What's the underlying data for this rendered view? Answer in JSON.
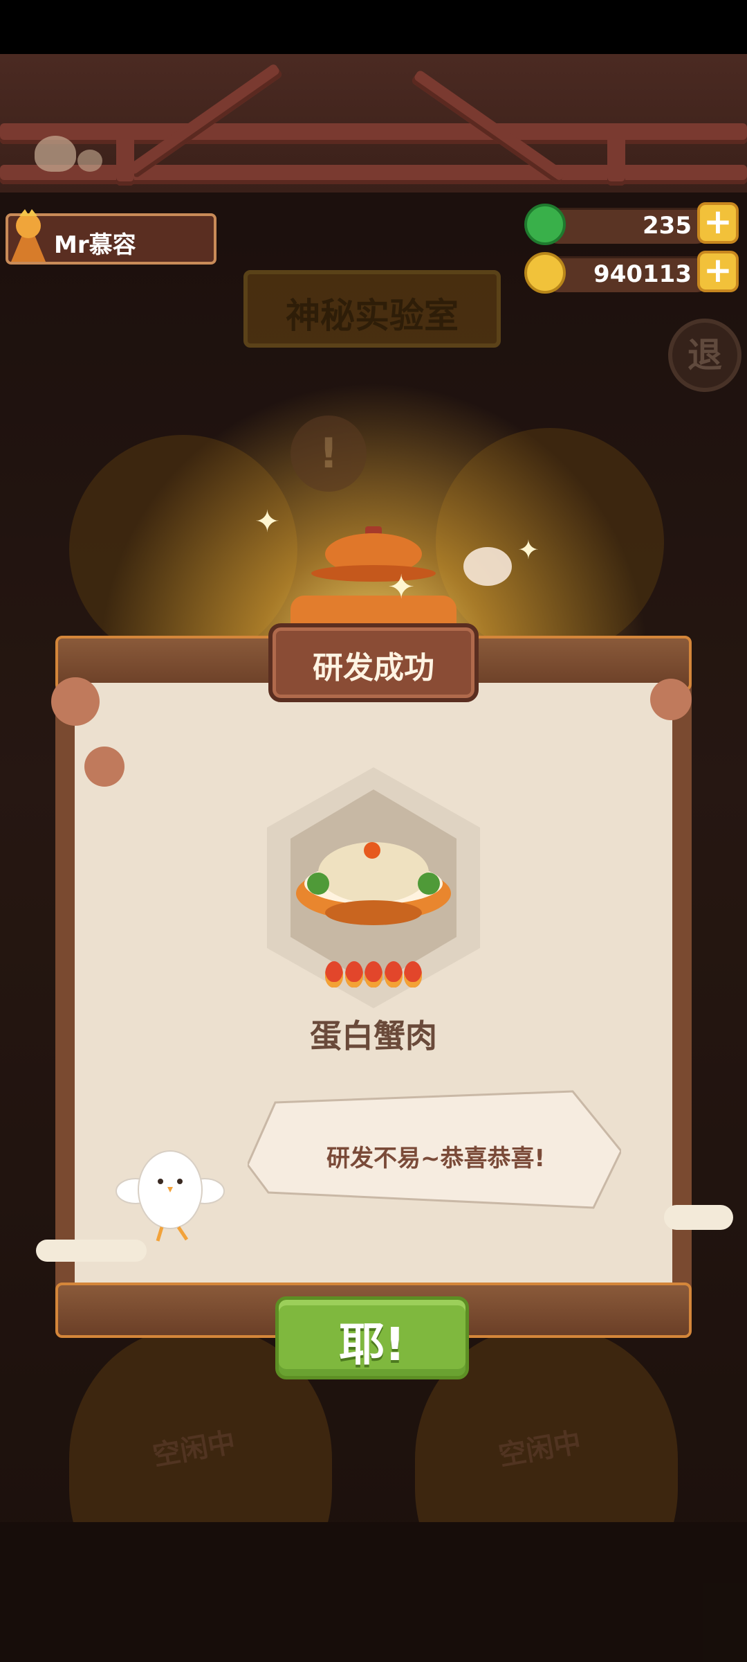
{
  "player": {
    "name": "Mr慕容"
  },
  "resources": {
    "gems": {
      "value": "235",
      "icon": "green-coin-icon",
      "add_icon": "plus-icon"
    },
    "coins": {
      "value": "940113",
      "icon": "gold-coin-icon",
      "add_icon": "plus-icon"
    }
  },
  "lab": {
    "title": "神秘实验室",
    "exit_label": "退"
  },
  "panel": {
    "title": "研发成功",
    "dish": {
      "name": "蛋白蟹肉",
      "rating": 5,
      "rating_icon": "flame-icon"
    },
    "message": "研发不易~恭喜恭喜!",
    "confirm_label": "耶!"
  },
  "pots": [
    {
      "status": "空闲中"
    },
    {
      "status": "空闲中"
    }
  ],
  "colors": {
    "panel_bg": "#ece0cf",
    "title_plate": "#8a4c35",
    "confirm_button": "#7fb83e",
    "resource_plus": "#f2c13a"
  }
}
